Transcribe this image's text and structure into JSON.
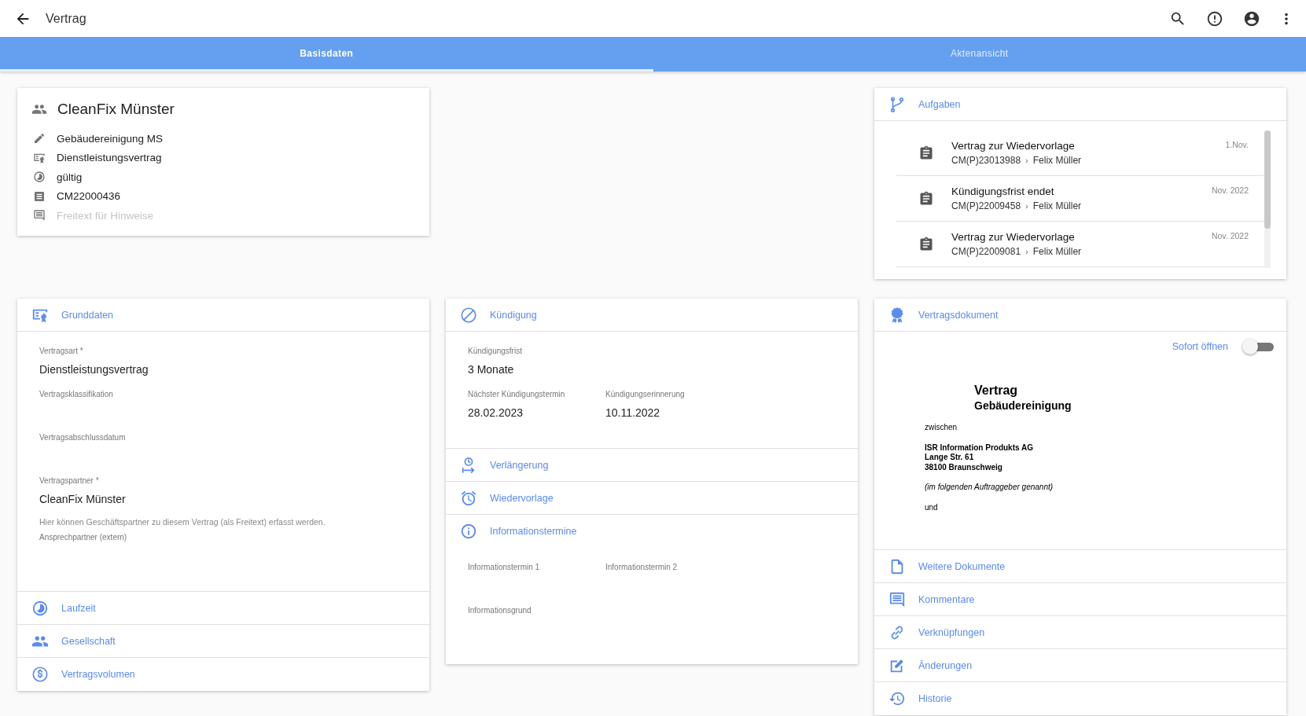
{
  "app_bar": {
    "title": "Vertrag"
  },
  "tabs": [
    {
      "label": "Basisdaten",
      "selected": true
    },
    {
      "label": "Aktenansicht",
      "selected": false
    }
  ],
  "summary": {
    "title": "CleanFix Münster",
    "rows": [
      {
        "kind": "edit",
        "value": "Gebäudereinigung MS"
      },
      {
        "kind": "contract",
        "value": "Dienstleistungsvertrag"
      },
      {
        "kind": "status",
        "value": "gültig"
      },
      {
        "kind": "number",
        "value": "CM22000436"
      },
      {
        "kind": "note",
        "placeholder": "Freitext für Hinweise"
      }
    ]
  },
  "tasks": {
    "title": "Aufgaben",
    "items": [
      {
        "title": "Vertrag zur Wiedervorlage",
        "ref": "CM(P)23013988",
        "separator": "›",
        "person": "Felix Müller",
        "date": "1.Nov."
      },
      {
        "title": "Kündigungsfrist endet",
        "ref": "CM(P)22009458",
        "separator": "›",
        "person": "Felix Müller",
        "date": "Nov. 2022"
      },
      {
        "title": "Vertrag zur Wiedervorlage",
        "ref": "CM(P)22009081",
        "separator": "›",
        "person": "Felix Müller",
        "date": "Nov. 2022"
      }
    ]
  },
  "columns": [
    {
      "panels": [
        {
          "kind": "contract",
          "title": "Grunddaten",
          "rows": [
            [
              {
                "label": "Vertragsart *",
                "value": "Dienstleistungsvertrag"
              }
            ],
            [
              {
                "label": "Vertragsklassifikation"
              }
            ],
            [
              {
                "label": "Vertragsabschlussdatum"
              }
            ],
            [
              {
                "label": "Vertragspartner *",
                "value": "CleanFix Münster",
                "hint": "Hier können Geschäftspartner zu diesem Vertrag (als Freitext) erfasst werden."
              }
            ],
            [
              {
                "label": "Ansprechpartner (extern)"
              }
            ]
          ]
        },
        {
          "kind": "term",
          "title": "Laufzeit"
        },
        {
          "kind": "company",
          "title": "Gesellschaft"
        },
        {
          "kind": "volume",
          "title": "Vertragsvolumen"
        }
      ]
    },
    {
      "panels": [
        {
          "kind": "cancel",
          "title": "Kündigung",
          "rows": [
            [
              {
                "label": "Kündigungsfrist",
                "value": "3 Monate"
              }
            ],
            [
              {
                "label": "Nächster Kündigungstermin",
                "value": "28.02.2023"
              },
              {
                "label": "Kündigungserinnerung",
                "value": "10.11.2022"
              }
            ]
          ]
        },
        {
          "kind": "extension",
          "title": "Verlängerung"
        },
        {
          "kind": "resubmission",
          "title": "Wiedervorlage"
        },
        {
          "kind": "info",
          "title": "Informationstermine",
          "rows": [
            [
              {
                "label": "Informationstermin 1"
              },
              {
                "label": "Informationstermin 2"
              }
            ],
            [
              {
                "label": "Informationsgrund"
              }
            ]
          ]
        }
      ]
    },
    {
      "panels": [
        {
          "kind": "document",
          "title": "Vertragsdokument",
          "toggle": {
            "label": "Sofort öffnen",
            "on": false
          },
          "preview": {
            "title": "Vertrag",
            "subtitle": "Gebäudereinigung",
            "paragraphs": [
              {
                "kind": "plain",
                "lines": [
                  "zwischen"
                ]
              },
              {
                "kind": "bold",
                "lines": [
                  "ISR Information Produkts AG",
                  "Lange Str. 61",
                  "38100 Braunschweig"
                ]
              },
              {
                "kind": "italic",
                "lines": [
                  "(im folgenden Auftraggeber genannt)"
                ]
              },
              {
                "kind": "plain",
                "lines": [
                  "und"
                ]
              }
            ]
          }
        },
        {
          "kind": "files",
          "title": "Weitere Dokumente"
        },
        {
          "kind": "comments",
          "title": "Kommentare"
        },
        {
          "kind": "links",
          "title": "Verknüpfungen"
        },
        {
          "kind": "changes",
          "title": "Änderungen"
        },
        {
          "kind": "history",
          "title": "Historie"
        }
      ]
    }
  ]
}
